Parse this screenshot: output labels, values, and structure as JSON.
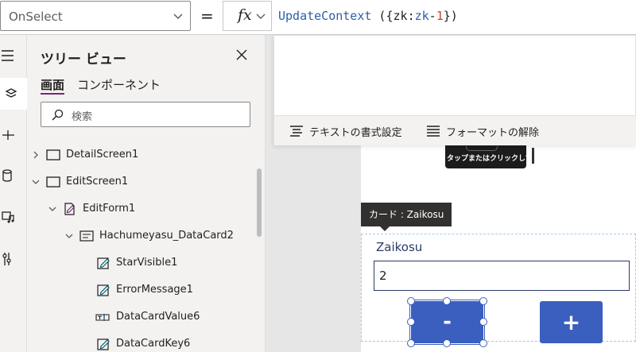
{
  "formula_bar": {
    "property": "OnSelect",
    "equals": "=",
    "fx_label": "fx",
    "formula": {
      "fn": "UpdateContext",
      "space_paren": " ({",
      "var": "zk",
      "colon": ":",
      "expr_var": "zk",
      "minus": "-",
      "num": "1",
      "close": "})"
    }
  },
  "format_toolbar": {
    "format_text": "テキストの書式設定",
    "remove_format": "フォーマットの解除"
  },
  "tree": {
    "title": "ツリー ビュー",
    "tabs": [
      "画面",
      "コンポーネント"
    ],
    "search_placeholder": "検索",
    "rows": [
      {
        "label": "DetailScreen1",
        "expanded": false,
        "icon": "screen-icon"
      },
      {
        "label": "EditScreen1",
        "expanded": true,
        "icon": "screen-icon"
      },
      {
        "label": "EditForm1",
        "expanded": true,
        "icon": "form-icon"
      },
      {
        "label": "Hachumeyasu_DataCard2",
        "expanded": true,
        "icon": "card-icon"
      },
      {
        "label": "StarVisible1",
        "icon": "edit-text-icon"
      },
      {
        "label": "ErrorMessage1",
        "icon": "edit-text-icon"
      },
      {
        "label": "DataCardValue6",
        "icon": "text-input-icon"
      },
      {
        "label": "DataCardKey6",
        "icon": "edit-text-icon"
      }
    ]
  },
  "canvas": {
    "gallery_caption": "タップまたはクリックして画像を追加",
    "tooltip": "カード : Zaikosu",
    "card_label": "Zaikosu",
    "card_value": "2",
    "minus_label": "-",
    "plus_label": "+"
  },
  "colors": {
    "accent": "#742774",
    "button": "#3b5fbf",
    "card_text": "#2b3a67"
  }
}
